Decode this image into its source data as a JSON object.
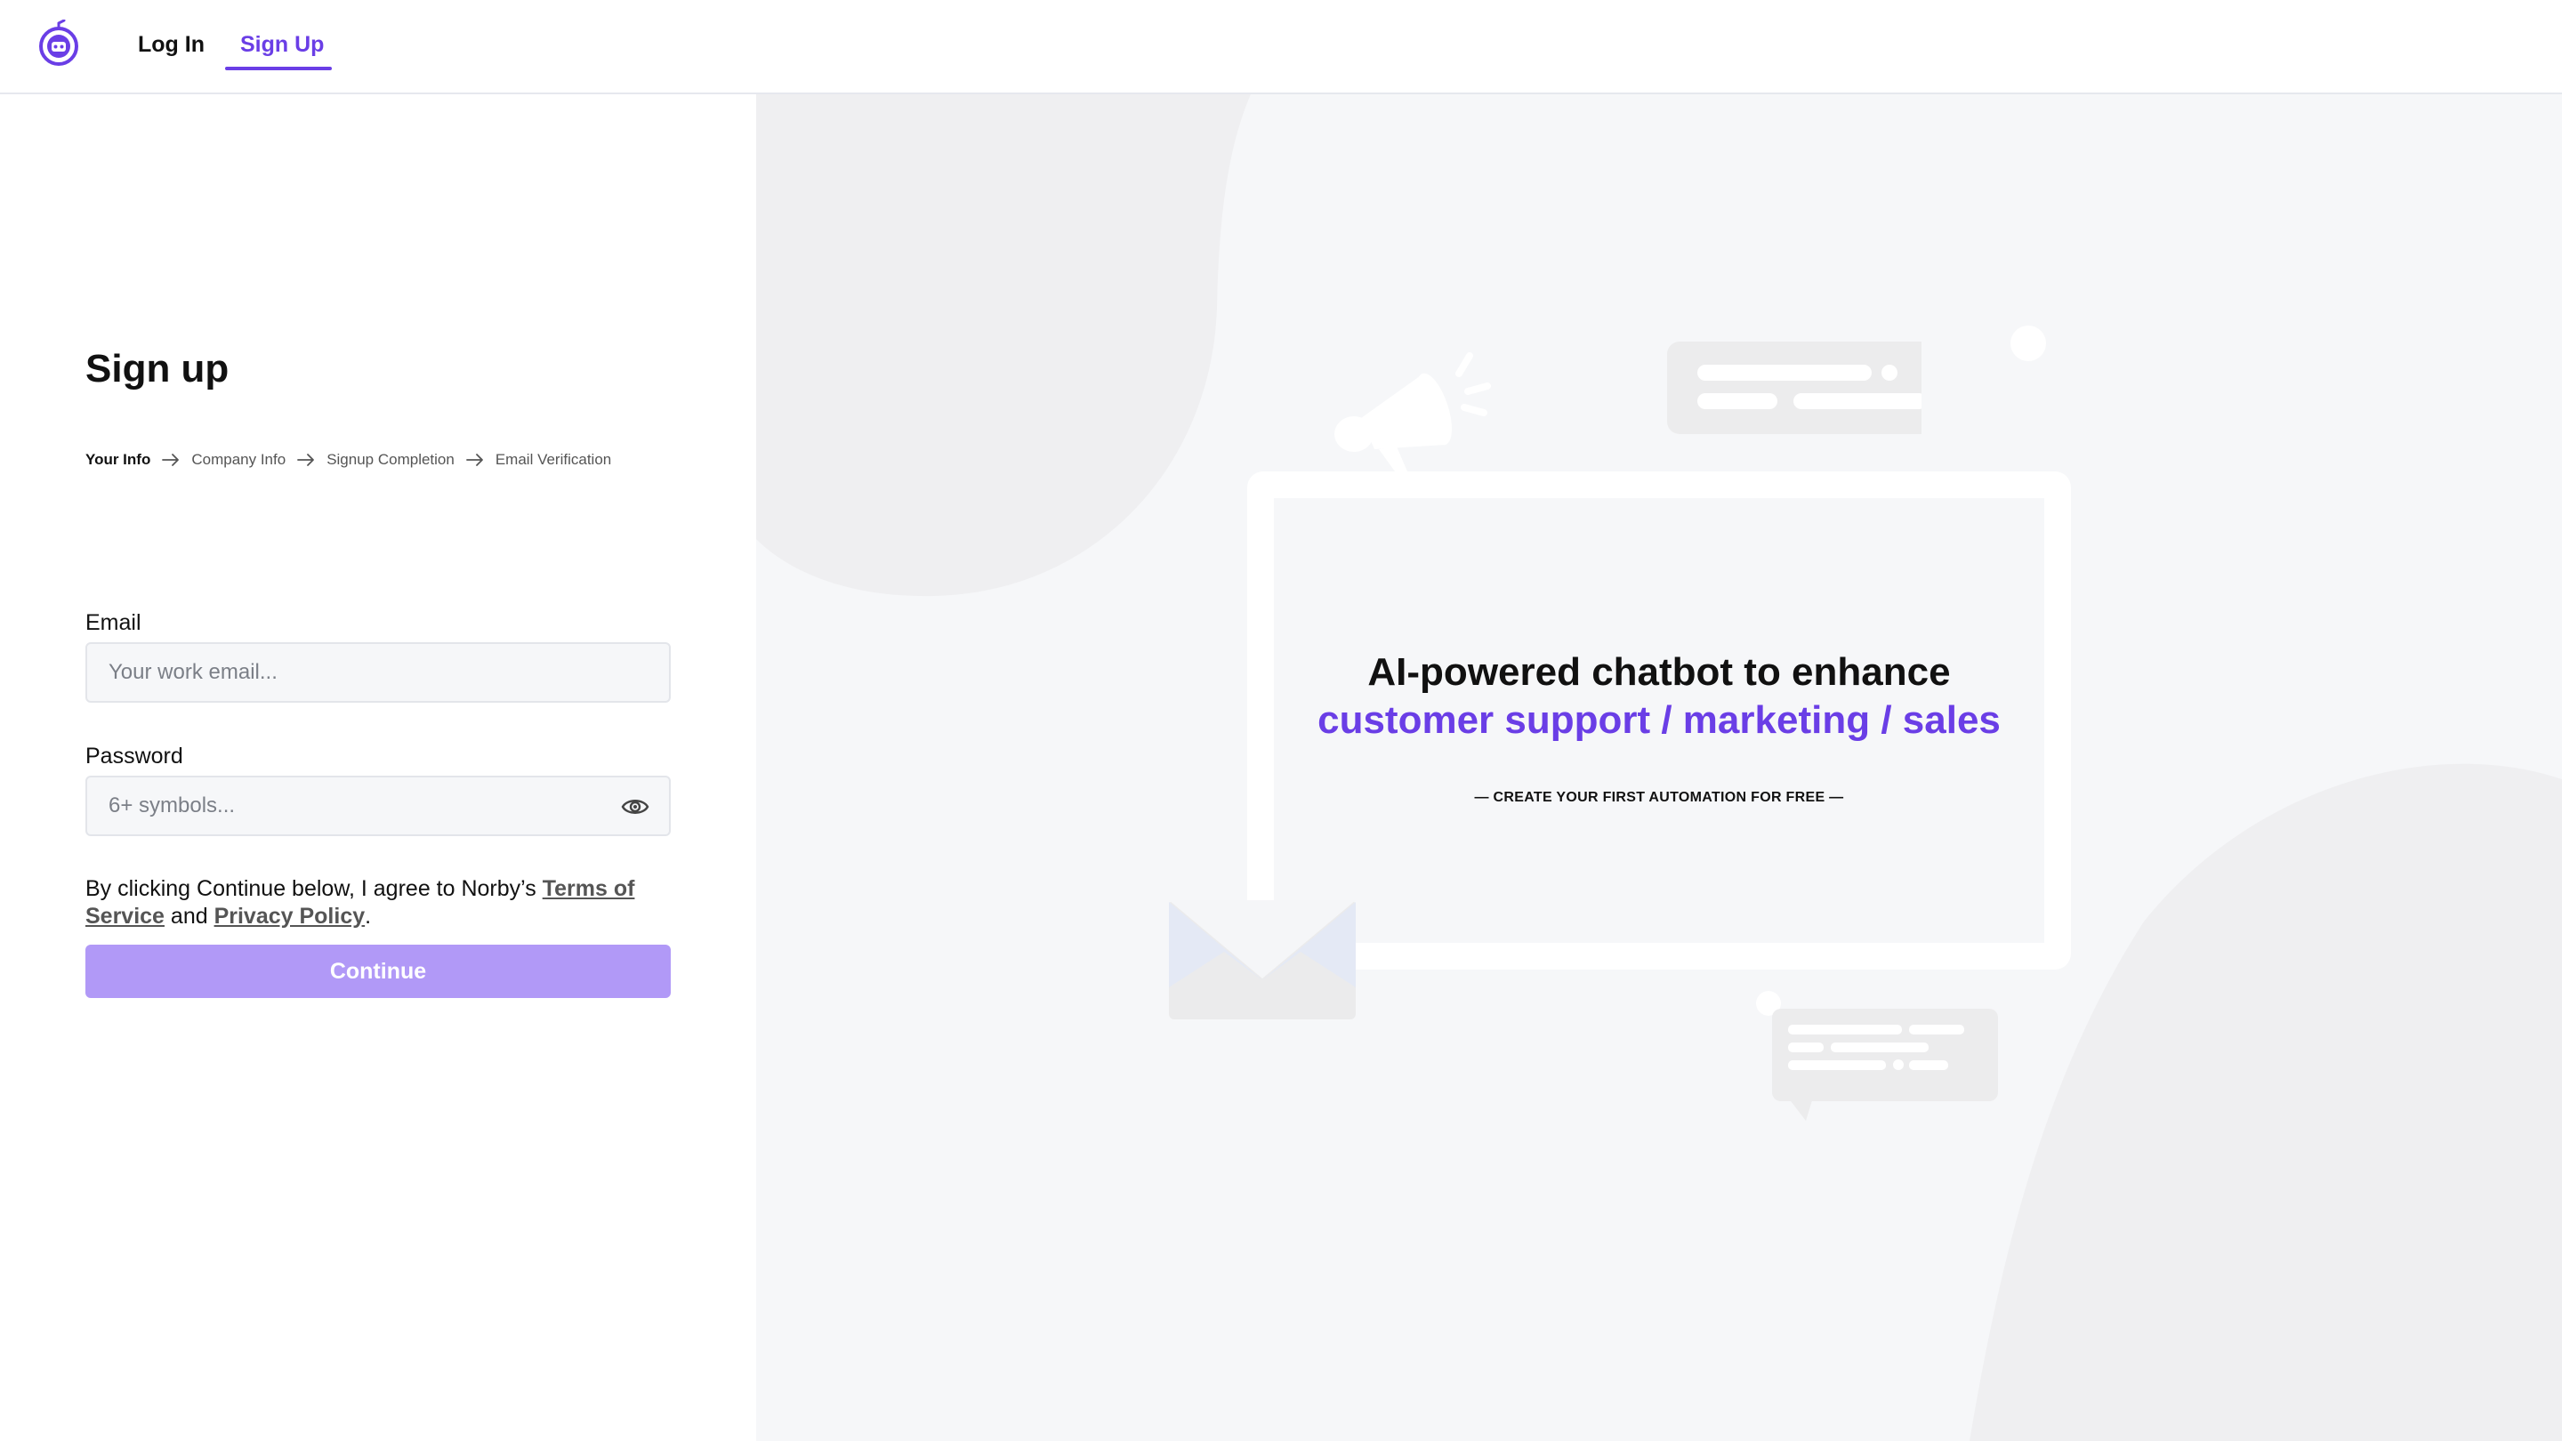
{
  "nav": {
    "login_label": "Log In",
    "signup_label": "Sign Up"
  },
  "form": {
    "title": "Sign up",
    "steps": [
      {
        "label": "Your Info",
        "active": true
      },
      {
        "label": "Company Info",
        "active": false
      },
      {
        "label": "Signup Completion",
        "active": false
      },
      {
        "label": "Email Verification",
        "active": false
      }
    ],
    "email": {
      "label": "Email",
      "value": "",
      "placeholder": "Your work email..."
    },
    "password": {
      "label": "Password",
      "value": "",
      "placeholder": "6+ symbols..."
    },
    "agreement": {
      "prefix": "By clicking Continue below, I agree to Norby’s ",
      "terms_link": "Terms of Service",
      "middle": " and ",
      "privacy_link": "Privacy Policy",
      "suffix": "."
    },
    "continue_label": "Continue"
  },
  "promo": {
    "headline": "AI-powered chatbot to enhance",
    "headline_accent": "customer support / marketing / sales",
    "tagline": "— CREATE YOUR FIRST AUTOMATION FOR FREE —"
  },
  "icons": [
    "logo-icon",
    "arrow-right-icon",
    "eye-icon",
    "megaphone-icon",
    "envelope-icon",
    "chat-bubble-icon"
  ],
  "colors": {
    "accent": "#6a3ee6",
    "button_disabled": "#b199f7",
    "panel_bg": "#f6f7f9",
    "blob": "#efeff1"
  }
}
